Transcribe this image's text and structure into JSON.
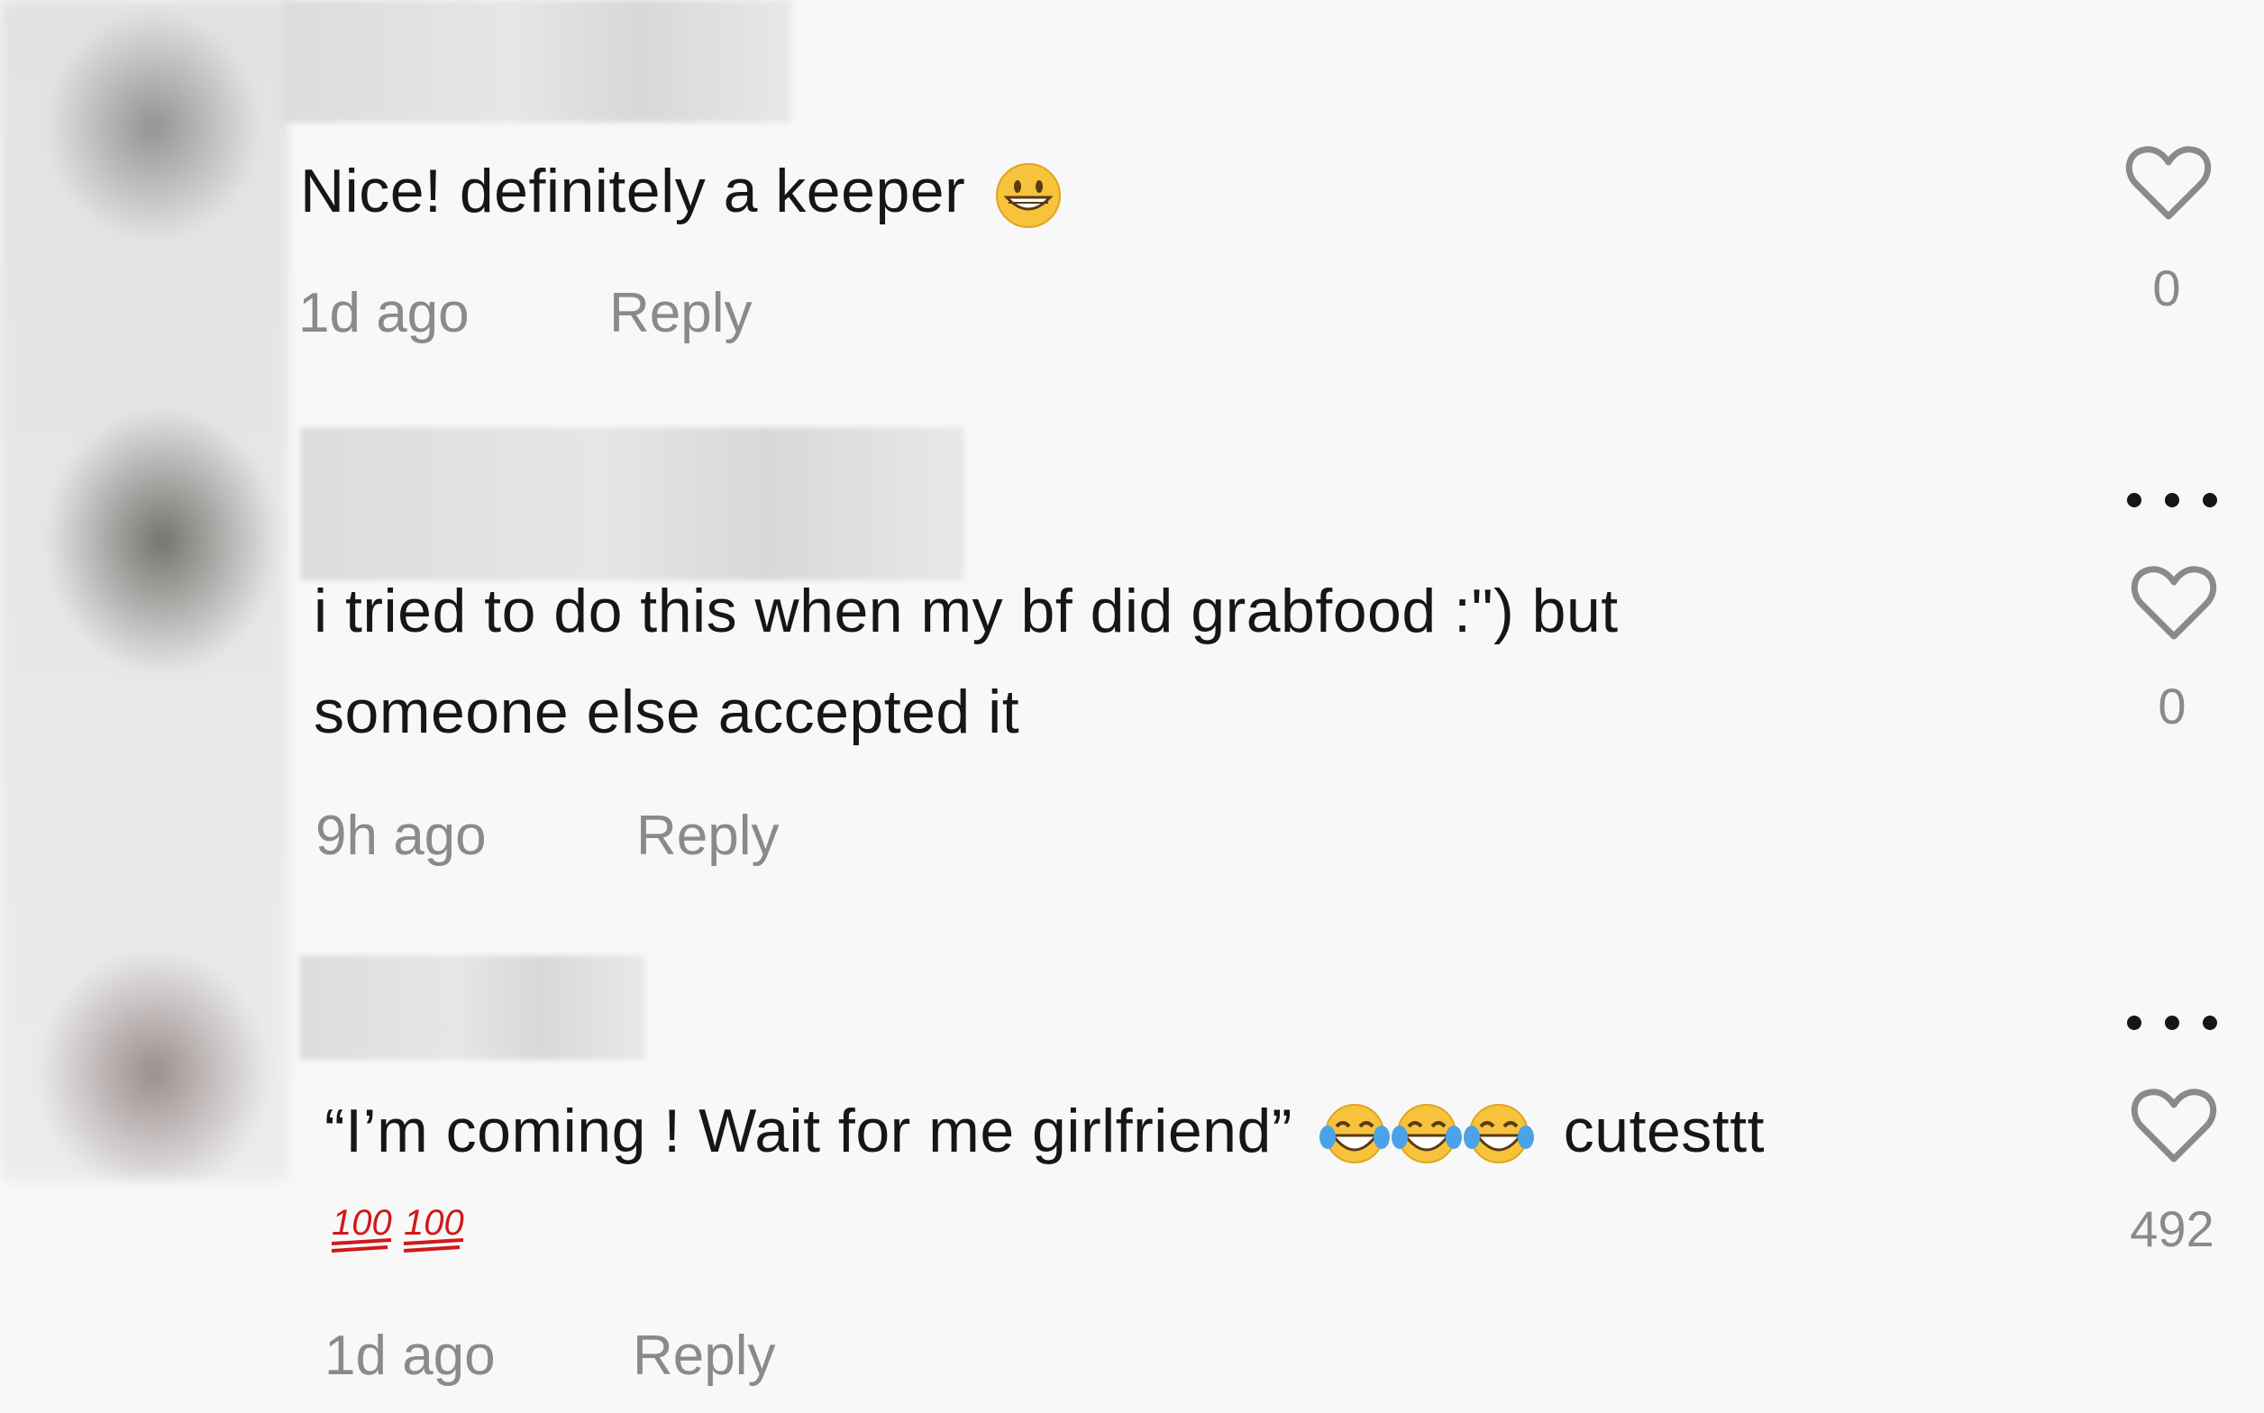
{
  "comments": [
    {
      "text": "Nice! definitely a keeper",
      "emoji": "grinning-face-emoji",
      "time": "1d ago",
      "reply": "Reply",
      "likes": "0"
    },
    {
      "text_line1": "i tried to do this when my bf did grabfood :\") but",
      "text_line2": "someone else accepted it",
      "time": "9h ago",
      "reply": "Reply",
      "likes": "0"
    },
    {
      "text_quote": "“I’m coming ! Wait for me girlfriend”",
      "emoji_laugh": "face-with-tears-of-joy-emoji",
      "text_tail": "cutesttt",
      "emoji_hundred": "hundred-points-emoji",
      "time": "1d ago",
      "reply": "Reply",
      "likes": "492"
    }
  ],
  "icons": {
    "like": "heart-outline-icon",
    "more": "more-dots-icon"
  },
  "colors": {
    "background": "#f8f8f8",
    "text": "#161616",
    "secondary": "#8a8a8a"
  }
}
